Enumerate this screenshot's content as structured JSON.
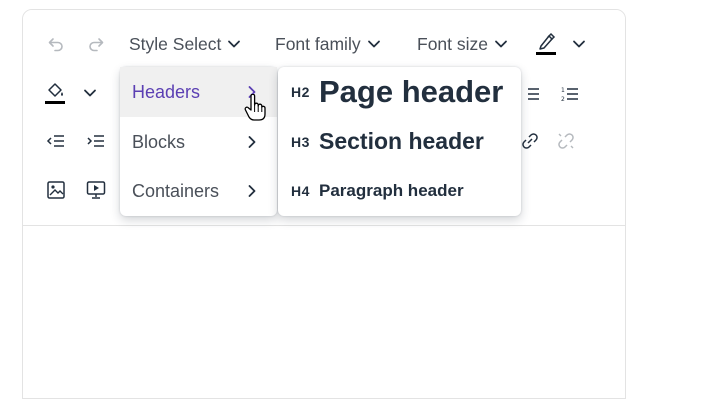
{
  "toolbar": {
    "undo_icon": "undo-icon",
    "redo_icon": "redo-icon",
    "style_select": "Style Select",
    "font_family": "Font family",
    "font_size": "Font size",
    "text_color_icon": "text-color-icon",
    "bg_color_icon": "background-color-icon"
  },
  "style_menu": {
    "items": [
      {
        "label": "Headers",
        "active": true
      },
      {
        "label": "Blocks",
        "active": false
      },
      {
        "label": "Containers",
        "active": false
      }
    ]
  },
  "headers_submenu": {
    "items": [
      {
        "code": "H2",
        "label": "Page header"
      },
      {
        "code": "H3",
        "label": "Section header"
      },
      {
        "code": "H4",
        "label": "Paragraph header"
      }
    ]
  },
  "colors": {
    "accent": "#5b3fb3",
    "menu_active_bg": "#f0f0f0",
    "icon": "#222f3e",
    "disabled": "#b5b9be",
    "border": "#e3e3e3"
  }
}
